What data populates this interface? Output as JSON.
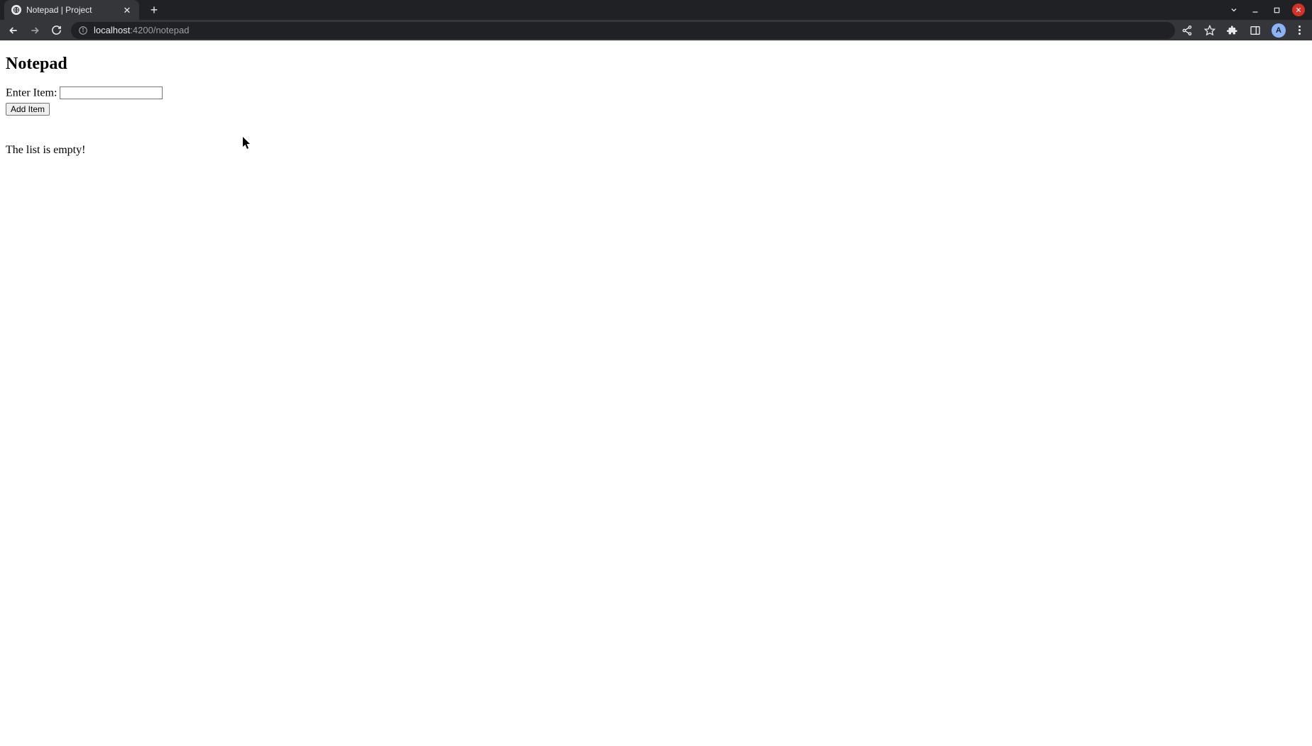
{
  "browser": {
    "tab_title": "Notepad | Project",
    "url_host": "localhost",
    "url_port_path": ":4200/notepad",
    "avatar_initial": "A"
  },
  "page": {
    "heading": "Notepad",
    "label": "Enter Item:",
    "input_value": "",
    "add_button": "Add Item",
    "empty_message": "The list is empty!"
  }
}
